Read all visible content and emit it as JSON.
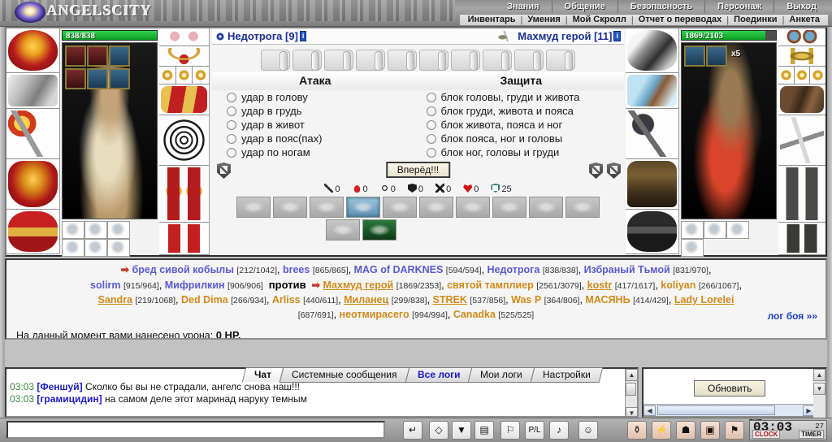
{
  "app": {
    "title": "ANGELSCITY",
    "logo_icon": "angel-orb-icon"
  },
  "menu": {
    "primary": [
      "Знания",
      "Общение",
      "Безопасность",
      "Персонаж",
      "Выход"
    ],
    "secondary": [
      "Инвентарь",
      "Умения",
      "Мой Скролл",
      "Отчет о переводах",
      "Поединки",
      "Анкета"
    ],
    "separator": "|"
  },
  "battle": {
    "left_player": {
      "name": "Недотрога",
      "level": "[9]",
      "info_badge": "i",
      "hp_current": 838,
      "hp_max": 838,
      "hp_label": "838/838"
    },
    "right_player": {
      "name": "Махмуд герой",
      "level": "[11]",
      "info_badge": "i",
      "hp_current": 1869,
      "hp_max": 2103,
      "hp_label": "1869/2103",
      "stack_count": "x5"
    },
    "attack": {
      "header": "Атака",
      "options": [
        "удар в голову",
        "удар в грудь",
        "удар в живот",
        "удар в пояс(пах)",
        "удар по ногам"
      ]
    },
    "defense": {
      "header": "Защита",
      "options": [
        "блок головы, груди и живота",
        "блок груди, живота и пояса",
        "блок живота, пояса и ног",
        "блок пояса, ног и головы",
        "блок ног, головы и груди"
      ]
    },
    "go_button": "Вперёд!!!",
    "stats": [
      {
        "icon": "slash-icon",
        "value": "0"
      },
      {
        "icon": "fire-drop-icon",
        "value": "0"
      },
      {
        "icon": "cycle-icon",
        "value": "0"
      },
      {
        "icon": "shield-filled-icon",
        "value": "0"
      },
      {
        "icon": "crossed-swords-icon",
        "value": "0"
      },
      {
        "icon": "heart-icon",
        "value": "0"
      },
      {
        "icon": "shield-outline-icon",
        "value": "25"
      }
    ],
    "abilities_row1": [
      "shield-ability-icon",
      "swipe-ability-icon",
      "head-ability-icon",
      "anchor-ability-icon",
      "hat-ability-icon",
      "crossed-blades-icon",
      "round-shield-icon",
      "dark-orb-icon",
      "hand-icon",
      "claw-icon"
    ],
    "abilities_row2": [
      "crossed-daggers-icon",
      "green-poison-icon"
    ],
    "selected_ability_index": 3,
    "selected_ability_row2_index": 1
  },
  "equipment": {
    "left_outer": [
      "helm-red",
      "bracers-steel",
      "hammer-weapon",
      "cuirass-red",
      "belt-red"
    ],
    "left_inner": [
      "earrings-red",
      "necklace-red",
      "rings-red",
      "gauntlets-red",
      "shield-web",
      "legs-red",
      "boots-red"
    ],
    "right_outer": [
      "helm-steel",
      "bracers-blue",
      "axe-dark",
      "cloak-brown",
      "belt-dark"
    ],
    "right_inner": [
      "earrings-blue",
      "amulet-gold",
      "rings-mixed",
      "gauntlets-brown",
      "sword-dagger",
      "legs-dark",
      "boots-dark"
    ]
  },
  "participants": {
    "arrow": "➡",
    "versus": "против",
    "team1": [
      {
        "name": "бред сивой кобылы",
        "hp": "[212/1042]",
        "leader": true,
        "underline": false
      },
      {
        "name": "brees",
        "hp": "[865/865]",
        "leader": false,
        "underline": false
      },
      {
        "name": "MAG of DARKNES",
        "hp": "[594/594]",
        "leader": false,
        "underline": false
      },
      {
        "name": "Недотрога",
        "hp": "[838/838]",
        "leader": false,
        "underline": false
      },
      {
        "name": "Избраный Тьмой",
        "hp": "[831/970]",
        "leader": false,
        "underline": false
      },
      {
        "name": "solirm",
        "hp": "[915/964]",
        "leader": false,
        "underline": false
      },
      {
        "name": "Мифрилкин",
        "hp": "[906/906]",
        "leader": false,
        "underline": false
      }
    ],
    "team2": [
      {
        "name": "Махмуд герой",
        "hp": "[1869/2353]",
        "leader": true,
        "underline": true
      },
      {
        "name": "святой тамплиер",
        "hp": "[2561/3079]",
        "leader": false,
        "underline": false
      },
      {
        "name": "kostr",
        "hp": "[417/1617]",
        "leader": false,
        "underline": true
      },
      {
        "name": "koliyan",
        "hp": "[266/1067]",
        "leader": false,
        "underline": false
      },
      {
        "name": "Sandra",
        "hp": "[219/1068]",
        "leader": false,
        "underline": true
      },
      {
        "name": "Ded Dima",
        "hp": "[266/934]",
        "leader": false,
        "underline": false
      },
      {
        "name": "Arliss",
        "hp": "[440/611]",
        "leader": false,
        "underline": false
      },
      {
        "name": "Миланец",
        "hp": "[299/838]",
        "leader": false,
        "underline": true
      },
      {
        "name": "STREK",
        "hp": "[537/856]",
        "leader": false,
        "underline": true
      },
      {
        "name": "Was P",
        "hp": "[364/806]",
        "leader": false,
        "underline": false
      },
      {
        "name": "МАСЯНЬ",
        "hp": "[414/429]",
        "leader": false,
        "underline": false
      },
      {
        "name": "Lady Lorelei",
        "hp": "[687/691]",
        "leader": false,
        "underline": true
      },
      {
        "name": "неотмирасего",
        "hp": "[994/994]",
        "leader": false,
        "underline": false
      },
      {
        "name": "Canadka",
        "hp": "[525/525]",
        "leader": false,
        "underline": false
      }
    ],
    "damage_text": "На данный момент вами нанесено урона:",
    "damage_value": "0 HP.",
    "log_link": "лог боя »»"
  },
  "chat": {
    "messages": [
      {
        "time": "03:03",
        "user": "Феншуй",
        "text": "Сколко бы вы не страдали, ангелс снова наш!!!"
      },
      {
        "time": "03:03",
        "user": "грамицидин",
        "text": "на самом деле этот маринад наруку темным"
      }
    ],
    "tabs": [
      {
        "label": "Чат",
        "active": true,
        "blue": false
      },
      {
        "label": "Системные сообщения",
        "active": false,
        "blue": false
      },
      {
        "label": "Все логи",
        "active": false,
        "blue": true
      },
      {
        "label": "Мои логи",
        "active": false,
        "blue": false
      },
      {
        "label": "Настройки",
        "active": false,
        "blue": false
      }
    ],
    "refresh_button": "Обновить",
    "input_value": "",
    "input_placeholder": ""
  },
  "toolbar": {
    "buttons": [
      {
        "icon": "enter-arrow-icon",
        "glyph": "↵"
      },
      {
        "icon": "eraser-icon",
        "glyph": "◇"
      },
      {
        "icon": "filter-icon",
        "glyph": "▼"
      },
      {
        "icon": "save-icon",
        "glyph": "▤"
      },
      {
        "icon": "run-person-icon",
        "glyph": "⚐"
      },
      {
        "icon": "pl-ratio-icon",
        "glyph": "P/L"
      },
      {
        "icon": "sound-note-icon",
        "glyph": "♪"
      },
      {
        "icon": "smiley-icon",
        "glyph": "☺"
      },
      {
        "icon": "potion-icon",
        "glyph": "⚱"
      },
      {
        "icon": "lightning-icon",
        "glyph": "⚡"
      },
      {
        "icon": "portrait-icon",
        "glyph": "☗"
      },
      {
        "icon": "bag-icon",
        "glyph": "▣"
      },
      {
        "icon": "flag-icon",
        "glyph": "⚑"
      },
      {
        "icon": "exit-door-icon",
        "glyph": "▯"
      }
    ],
    "exit_label": "EXIT",
    "clock_time": "03:03",
    "clock_seconds": "27",
    "clock_label": "CLOCK",
    "timer_label": "TIMER"
  },
  "colors": {
    "accent_blue": "#1b2f8f",
    "team1": "#5a5ad0",
    "team2": "#d08a1a",
    "hp_green": "#0a9e22",
    "link": "#1a3fc4"
  }
}
